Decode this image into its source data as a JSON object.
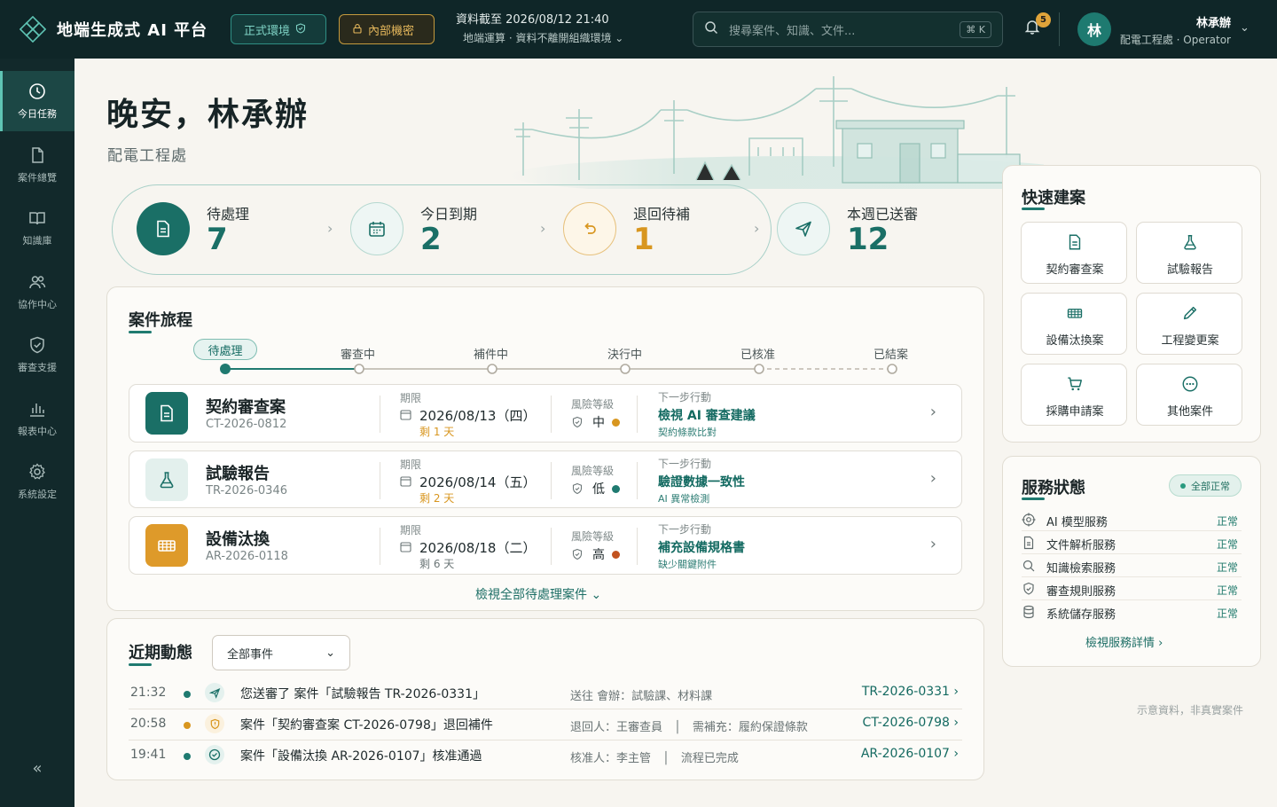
{
  "app": {
    "name": "地端生成式 AI 平台"
  },
  "env": {
    "prod": "正式環境",
    "confidential": "內部機密"
  },
  "data_info": {
    "line1": "資料截至 2026/08/12 21:40",
    "line2": "地端運算 · 資料不離開組織環境"
  },
  "search": {
    "placeholder": "搜尋案件、知識、文件...",
    "shortcut": "⌘ K"
  },
  "notifications": {
    "count": "5"
  },
  "user": {
    "avatar": "林",
    "name": "林承辦",
    "role": "配電工程處 · Operator"
  },
  "sidebar": {
    "items": [
      {
        "label": "今日任務",
        "icon": "clock-icon",
        "active": true
      },
      {
        "label": "案件總覽",
        "icon": "file-icon"
      },
      {
        "label": "知識庫",
        "icon": "book-icon"
      },
      {
        "label": "協作中心",
        "icon": "users-icon"
      },
      {
        "label": "審查支援",
        "icon": "shield-check-icon"
      },
      {
        "label": "報表中心",
        "icon": "bar-chart-icon"
      },
      {
        "label": "系統設定",
        "icon": "gear-icon"
      }
    ],
    "collapse": "«"
  },
  "greeting": {
    "title": "晚安，林承辦",
    "dept": "配電工程處"
  },
  "stats": [
    {
      "label": "待處理",
      "value": "7",
      "icon": "document-icon"
    },
    {
      "label": "今日到期",
      "value": "2",
      "icon": "calendar-icon"
    },
    {
      "label": "退回待補",
      "value": "1",
      "icon": "undo-icon"
    },
    {
      "label": "本週已送審",
      "value": "12",
      "icon": "send-icon"
    }
  ],
  "journey": {
    "title": "案件旅程",
    "stages": [
      "待處理",
      "審查中",
      "補件中",
      "決行中",
      "已核准",
      "已結案"
    ],
    "cases": [
      {
        "name": "契約審查案",
        "id": "CT-2026-0812",
        "due_label": "期限",
        "due": "2026/08/13（四）",
        "remain": "剩 1 天",
        "risk_label": "風險等級",
        "risk": "中",
        "risk_color": "#d8961f",
        "next_label": "下一步行動",
        "next": "檢視 AI 審查建議",
        "next_sub": "契約條款比對",
        "icon": "document-icon"
      },
      {
        "name": "試驗報告",
        "id": "TR-2026-0346",
        "due_label": "期限",
        "due": "2026/08/14（五）",
        "remain": "剩 2 天",
        "risk_label": "風險等級",
        "risk": "低",
        "risk_color": "#1f7a70",
        "next_label": "下一步行動",
        "next": "驗證數據一致性",
        "next_sub": "AI 異常檢測",
        "icon": "flask-icon"
      },
      {
        "name": "設備汰換",
        "id": "AR-2026-0118",
        "due_label": "期限",
        "due": "2026/08/18（二）",
        "remain": "剩 6 天",
        "risk_label": "風險等級",
        "risk": "高",
        "risk_color": "#c2531f",
        "next_label": "下一步行動",
        "next": "補充設備規格書",
        "next_sub": "缺少關鍵附件",
        "icon": "equipment-icon"
      }
    ],
    "view_all": "檢視全部待處理案件 ⌄"
  },
  "activity": {
    "title": "近期動態",
    "filter": "全部事件",
    "rows": [
      {
        "time": "21:32",
        "dot": "#1f7a70",
        "icon": "send-icon",
        "text": "您送審了 案件「試驗報告 TR-2026-0331」",
        "meta": "送往 會辦：試驗課、材料課",
        "link": "TR-2026-0331 ›"
      },
      {
        "time": "20:58",
        "dot": "#d8961f",
        "icon": "shield-alert-icon",
        "text": "案件「契約審查案 CT-2026-0798」退回補件",
        "meta": "退回人：王審查員　│　需補充：履約保證條款",
        "link": "CT-2026-0798 ›"
      },
      {
        "time": "19:41",
        "dot": "#1f7a70",
        "icon": "check-circle-icon",
        "text": "案件「設備汰換 AR-2026-0107」核准通過",
        "meta": "核准人：李主管　│　流程已完成",
        "link": "AR-2026-0107 ›"
      }
    ]
  },
  "quick_create": {
    "title": "快速建案",
    "tiles": [
      {
        "label": "契約審查案",
        "icon": "document-icon"
      },
      {
        "label": "試驗報告",
        "icon": "flask-icon"
      },
      {
        "label": "設備汰換案",
        "icon": "equipment-icon"
      },
      {
        "label": "工程變更案",
        "icon": "pencil-icon"
      },
      {
        "label": "採購申請案",
        "icon": "cart-icon"
      },
      {
        "label": "其他案件",
        "icon": "more-icon"
      }
    ]
  },
  "services": {
    "title": "服務狀態",
    "overall": "全部正常",
    "items": [
      {
        "name": "AI 模型服務",
        "status": "正常",
        "icon": "target-icon"
      },
      {
        "name": "文件解析服務",
        "status": "正常",
        "icon": "document-icon"
      },
      {
        "name": "知識檢索服務",
        "status": "正常",
        "icon": "search-icon"
      },
      {
        "name": "審查規則服務",
        "status": "正常",
        "icon": "shield-check-icon"
      },
      {
        "name": "系統儲存服務",
        "status": "正常",
        "icon": "database-icon"
      }
    ],
    "more": "檢視服務詳情 ›"
  },
  "footnote": "示意資料，非真實案件",
  "colors": {
    "accent": "#1f7a70",
    "warning": "#d8961f",
    "danger": "#c2531f",
    "topbar": "#0f2628"
  }
}
